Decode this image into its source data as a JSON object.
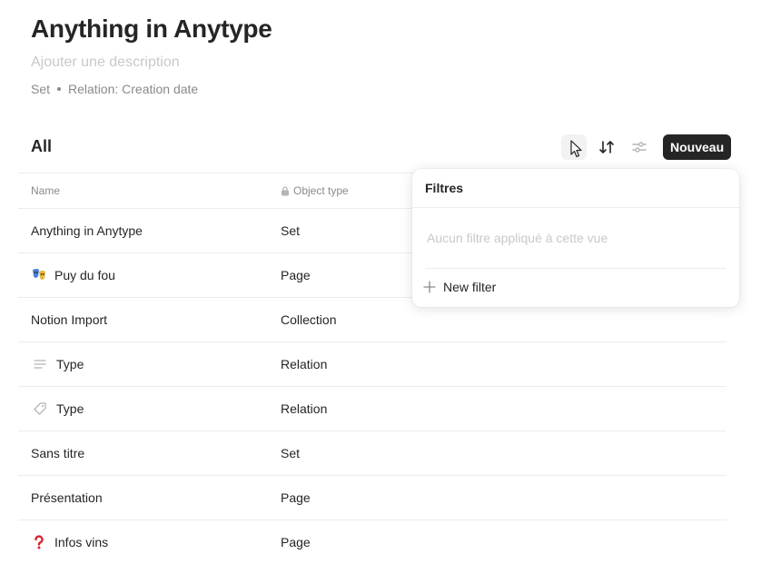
{
  "page": {
    "title": "Anything in Anytype",
    "description_placeholder": "Ajouter une description",
    "meta_kind": "Set",
    "meta_relation": "Relation: Creation date"
  },
  "view": {
    "title": "All",
    "new_button": "Nouveau"
  },
  "table": {
    "headers": {
      "name": "Name",
      "type": "Object type"
    },
    "rows": [
      {
        "name": "Anything in Anytype",
        "type": "Set",
        "icon": "none"
      },
      {
        "name": "Puy du fou",
        "type": "Page",
        "icon": "theater-masks-emoji"
      },
      {
        "name": "Notion Import",
        "type": "Collection",
        "icon": "none"
      },
      {
        "name": "Type",
        "type": "Relation",
        "icon": "text-lines-icon"
      },
      {
        "name": "Type",
        "type": "Relation",
        "icon": "tag-icon"
      },
      {
        "name": "Sans titre",
        "type": "Set",
        "icon": "none"
      },
      {
        "name": "Présentation",
        "type": "Page",
        "icon": "none"
      },
      {
        "name": "Infos vins",
        "type": "Page",
        "icon": "red-question-mark-emoji"
      }
    ]
  },
  "filters_popup": {
    "title": "Filtres",
    "empty_text": "Aucun filtre appliqué à cette vue",
    "new_filter": "New filter"
  }
}
